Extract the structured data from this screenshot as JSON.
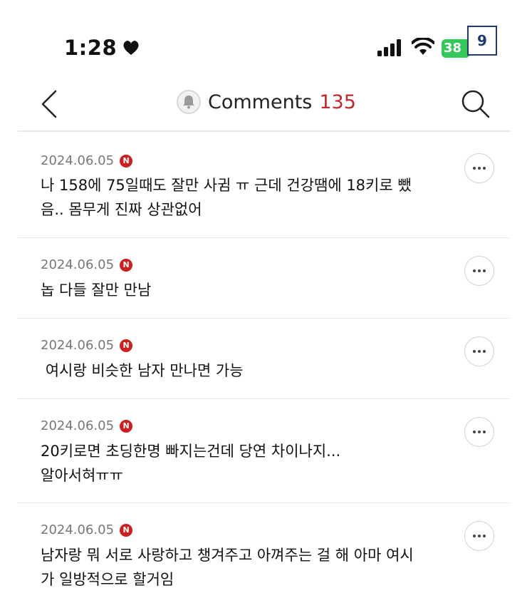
{
  "status_bar": {
    "time": "1:28",
    "battery": "38",
    "page_badge": "9"
  },
  "header": {
    "title": "Comments",
    "count": "135"
  },
  "icons": [
    "heart-icon",
    "signal-icon",
    "wifi-icon",
    "back-chevron-icon",
    "bell-icon",
    "search-icon",
    "more-icon",
    "naver-n-icon"
  ],
  "colors": {
    "count_red": "#c0282d",
    "battery_green": "#34c759",
    "badge_red": "#cc1f1f"
  },
  "comments": [
    {
      "date": "2024.06.05",
      "badge": "N",
      "text": "나 158에 75일때도 잘만 사귐 ㅠ 근데 건강땜에 18키로 뺐\n음.. 몸무게 진짜 상관없어"
    },
    {
      "date": "2024.06.05",
      "badge": "N",
      "text": "놉 다들 잘만 만남"
    },
    {
      "date": "2024.06.05",
      "badge": "N",
      "text": " 여시랑 비슷한 남자 만나면 가능"
    },
    {
      "date": "2024.06.05",
      "badge": "N",
      "text": "20키로면 초딩한명 빠지는건데 당연 차이나지...\n알아서혀ㅠㅠ"
    },
    {
      "date": "2024.06.05",
      "badge": "N",
      "text": "남자랑 뭐 서로 사랑하고 챙겨주고 아껴주는 걸 해 아마 여시\n가 일방적으로 할거임"
    }
  ]
}
